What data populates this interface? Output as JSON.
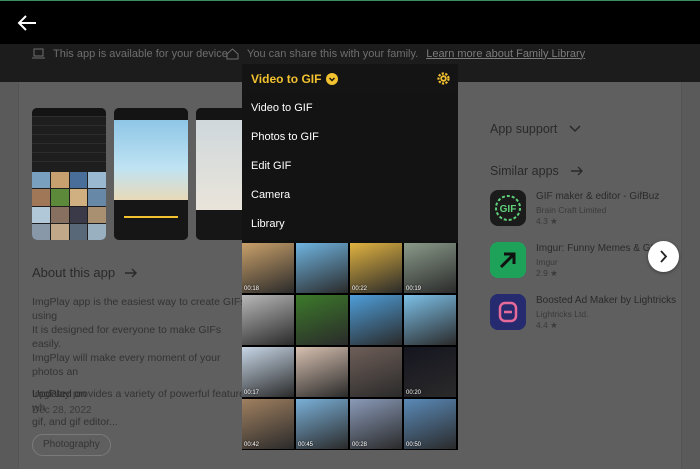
{
  "header": {
    "back_label": "Back"
  },
  "info_strip": {
    "device_text": "This app is available for your device",
    "family_text": "You can share this with your family.",
    "family_link": "Learn more about Family Library"
  },
  "about": {
    "heading": "About this app",
    "desc_lines": [
      "ImgPlay app is the easiest way to create GIFs using",
      "It is designed for everyone to make GIFs easily.",
      "ImgPlay will make every moment of your photos an"
    ],
    "desc_lines2": [
      "ImgPlay provides a variety of powerful features wh",
      "gif, and gif editor..."
    ],
    "updated_label": "Updated on",
    "updated_date": "Dec 28, 2022",
    "category_chip": "Photography"
  },
  "sidebar": {
    "app_support": "App support",
    "similar_apps": "Similar apps",
    "apps": [
      {
        "title": "GIF maker & editor - GifBuz",
        "developer": "Brain Craft Limited",
        "rating": "4.3 ★",
        "color": "#1b1b1b",
        "icon": "gif-icon"
      },
      {
        "title": "Imgur: Funny Memes & GIF",
        "developer": "Imgur",
        "rating": "2.9 ★",
        "color": "#1ea25a",
        "icon": "arrow-up-icon"
      },
      {
        "title": "Boosted Ad Maker by Lightricks",
        "developer": "Lightricks Ltd.",
        "rating": "4.4 ★",
        "color": "#3b3f9c",
        "icon": "b-logo-icon"
      }
    ]
  },
  "overlay": {
    "title": "Video to GIF",
    "menu_items": [
      "Video to GIF",
      "Photos to GIF",
      "Edit GIF",
      "Camera",
      "Library"
    ],
    "tiles": [
      {
        "dur": "00:18",
        "color": "#c9a06a"
      },
      {
        "dur": "",
        "color": "#6fb4e0"
      },
      {
        "dur": "00:22",
        "color": "#e0b240"
      },
      {
        "dur": "00:19",
        "color": "#8a9a8a"
      },
      {
        "dur": "",
        "color": "#b8b8b8"
      },
      {
        "dur": "",
        "color": "#3c7a2a"
      },
      {
        "dur": "",
        "color": "#4e9ed9"
      },
      {
        "dur": "",
        "color": "#7cc0e8"
      },
      {
        "dur": "00:17",
        "color": "#c7d6e6"
      },
      {
        "dur": "",
        "color": "#d7c0b0"
      },
      {
        "dur": "",
        "color": "#6e5e58"
      },
      {
        "dur": "00:20",
        "color": "#151520"
      },
      {
        "dur": "00:42",
        "color": "#a08060"
      },
      {
        "dur": "00:45",
        "color": "#7ab0d8"
      },
      {
        "dur": "00:28",
        "color": "#8a9ab8"
      },
      {
        "dur": "00:50",
        "color": "#5a8ab8"
      }
    ]
  },
  "colors": {
    "accent": "#f2c230"
  }
}
